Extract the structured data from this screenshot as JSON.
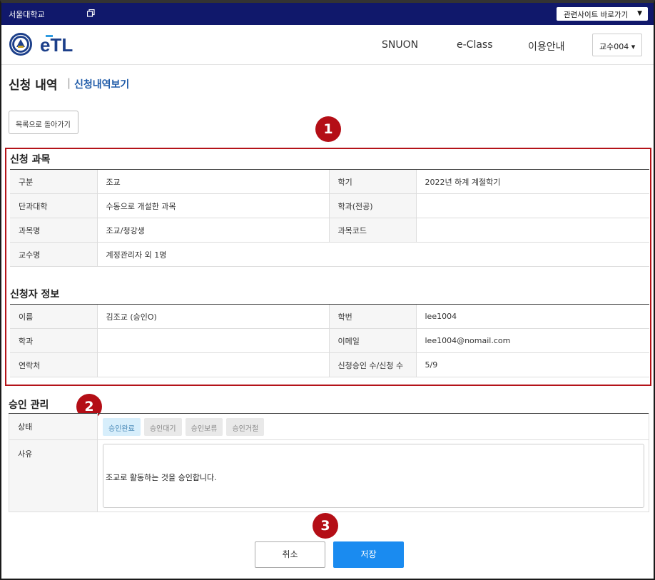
{
  "topbar": {
    "school_name": "서울대학교",
    "related_sites": "관련사이트 바로가기",
    "related_arrow": "▼"
  },
  "header": {
    "logo_text": "eTL",
    "nav": [
      "SNUON",
      "e-Class",
      "이용안내"
    ],
    "user_menu": "교수004 ▾"
  },
  "page": {
    "title": "신청 내역",
    "separator": "|",
    "subtitle": "신청내역보기",
    "back_button": "목록으로 돌아가기"
  },
  "badges": [
    "1",
    "2",
    "3"
  ],
  "course_section": {
    "title": "신청 과목",
    "rows": [
      {
        "l1": "구분",
        "v1": "조교",
        "l2": "학기",
        "v2": "2022년 하계 계절학기"
      },
      {
        "l1": "단과대학",
        "v1": "수동으로 개설한 과목",
        "l2": "학과(전공)",
        "v2": ""
      },
      {
        "l1": "과목명",
        "v1": "조교/청강생",
        "l2": "과목코드",
        "v2": ""
      },
      {
        "l1": "교수명",
        "v1": "계정관리자 외 1명"
      }
    ]
  },
  "applicant_section": {
    "title": "신청자 정보",
    "rows": [
      {
        "l1": "이름",
        "v1": "김조교 (승인O)",
        "l2": "학번",
        "v2": "lee1004"
      },
      {
        "l1": "학과",
        "v1": "",
        "l2": "이메일",
        "v2": "lee1004@nomail.com"
      },
      {
        "l1": "연락처",
        "v1": "",
        "l2": "신청승인 수/신청 수",
        "v2": "5/9"
      }
    ]
  },
  "approval_section": {
    "title": "승인 관리",
    "status_label": "상태",
    "status_options": [
      "승인완료",
      "승인대기",
      "승인보류",
      "승인거절"
    ],
    "selected_status": "승인완료",
    "reason_label": "사유",
    "reason_text": "조교로 활동하는 것을 승인합니다."
  },
  "actions": {
    "cancel": "취소",
    "save": "저장"
  },
  "colors": {
    "topbar": "#10186b",
    "badge": "#b40e16",
    "highlight_border": "#b41319",
    "subtitle": "#1e5aa8",
    "save_button": "#1a8bf0",
    "active_status_bg": "#d7eefb"
  }
}
